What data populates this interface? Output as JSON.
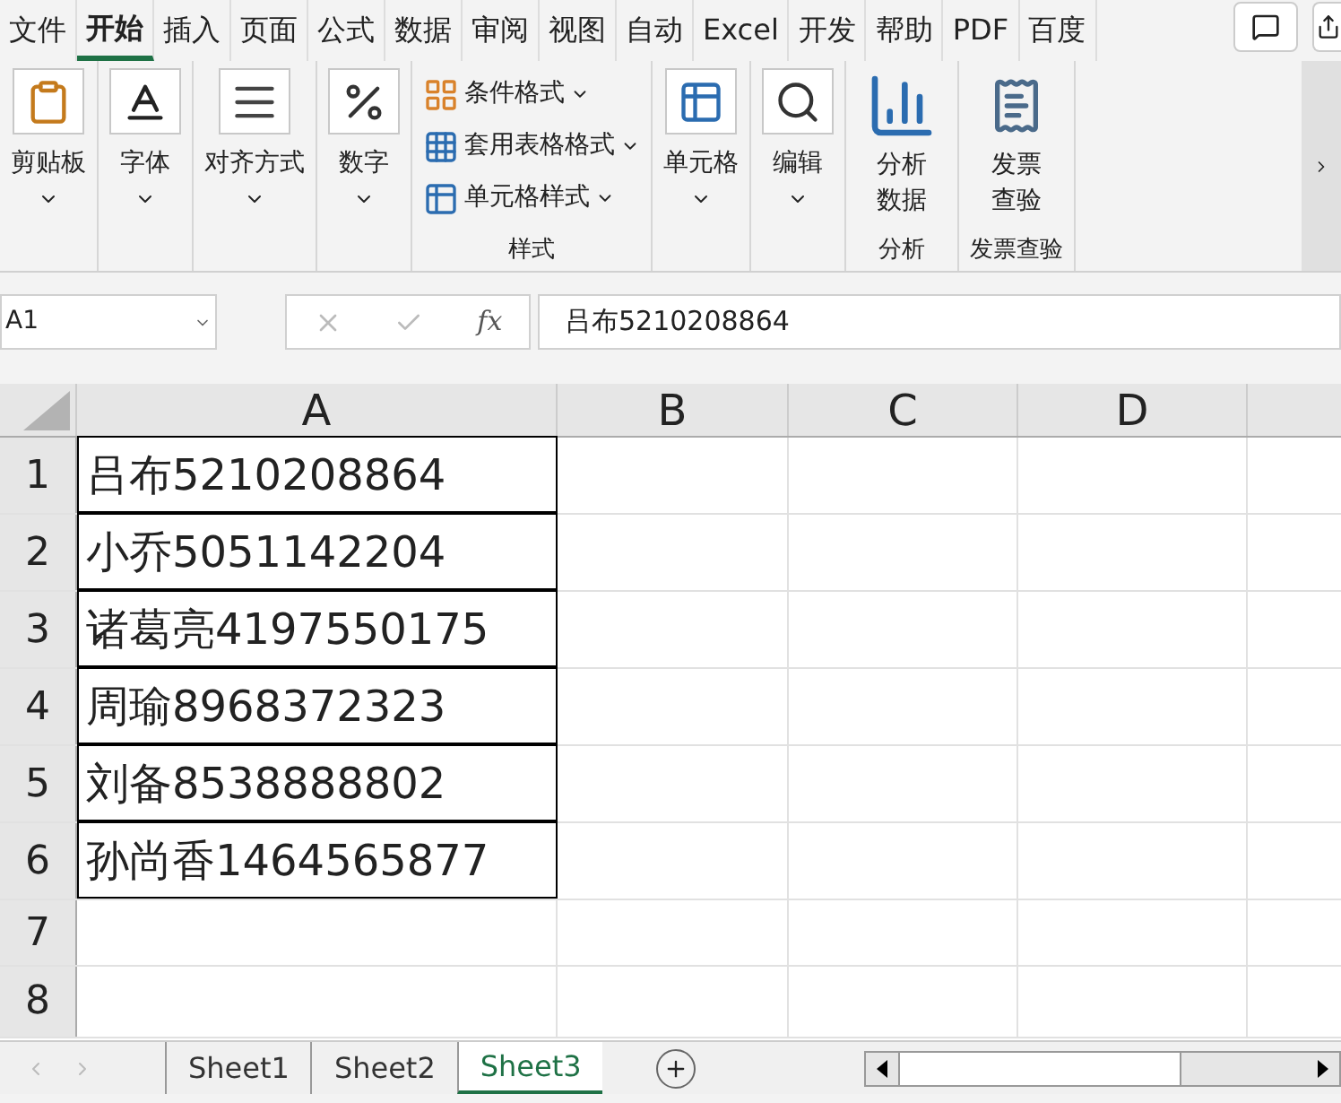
{
  "menu_tabs": [
    {
      "label": "文件",
      "selected": false
    },
    {
      "label": "开始",
      "selected": true
    },
    {
      "label": "插入",
      "selected": false
    },
    {
      "label": "页面",
      "selected": false
    },
    {
      "label": "公式",
      "selected": false
    },
    {
      "label": "数据",
      "selected": false
    },
    {
      "label": "审阅",
      "selected": false
    },
    {
      "label": "视图",
      "selected": false
    },
    {
      "label": "自动",
      "selected": false
    },
    {
      "label": "Excel",
      "selected": false
    },
    {
      "label": "开发",
      "selected": false
    },
    {
      "label": "帮助",
      "selected": false
    },
    {
      "label": "PDF",
      "selected": false
    },
    {
      "label": "百度",
      "selected": false
    }
  ],
  "ribbon_groups": [
    {
      "items": [
        {
          "kind": "large",
          "lines": [
            "剪贴板"
          ],
          "dropdown": true
        }
      ]
    },
    {
      "items": [
        {
          "kind": "large",
          "lines": [
            "字体"
          ],
          "dropdown": true
        }
      ]
    },
    {
      "items": [
        {
          "kind": "large",
          "lines": [
            "对齐方式"
          ],
          "dropdown": true
        }
      ]
    },
    {
      "items": [
        {
          "kind": "large",
          "lines": [
            "数字"
          ],
          "dropdown": true
        }
      ]
    },
    {
      "label": "样式",
      "items": [
        {
          "kind": "small",
          "lines": [
            "条件格式"
          ],
          "dropdown": true
        },
        {
          "kind": "small",
          "lines": [
            "套用表格格式"
          ],
          "dropdown": true
        },
        {
          "kind": "small",
          "lines": [
            "单元格样式"
          ],
          "dropdown": true
        }
      ]
    },
    {
      "items": [
        {
          "kind": "large",
          "lines": [
            "单元格"
          ],
          "dropdown": true
        }
      ]
    },
    {
      "items": [
        {
          "kind": "large",
          "lines": [
            "编辑"
          ],
          "dropdown": true
        }
      ]
    },
    {
      "label": "分析",
      "items": [
        {
          "kind": "large",
          "lines": [
            "分析",
            "数据"
          ],
          "dropdown": false
        }
      ]
    },
    {
      "label": "发票查验",
      "items": [
        {
          "kind": "large",
          "lines": [
            "发票",
            "查验"
          ],
          "dropdown": false
        }
      ]
    }
  ],
  "formula_bar": {
    "name_box": "A1",
    "fx_label": "fx",
    "formula": "吕布5210208864"
  },
  "columns": [
    "A",
    "B",
    "C",
    "D"
  ],
  "rows": [
    {
      "header": "1",
      "cells": [
        "吕布5210208864"
      ]
    },
    {
      "header": "2",
      "cells": [
        "小乔5051142204"
      ]
    },
    {
      "header": "3",
      "cells": [
        "诸葛亮4197550175"
      ]
    },
    {
      "header": "4",
      "cells": [
        "周瑜8968372323"
      ]
    },
    {
      "header": "5",
      "cells": [
        "刘备8538888802"
      ]
    },
    {
      "header": "6",
      "cells": [
        "孙尚香1464565877"
      ]
    },
    {
      "header": "7",
      "cells": []
    },
    {
      "header": "8",
      "cells": []
    }
  ],
  "sheet_tabs": [
    {
      "label": "Sheet1",
      "selected": false
    },
    {
      "label": "Sheet2",
      "selected": false
    },
    {
      "label": "Sheet3",
      "selected": true
    }
  ]
}
